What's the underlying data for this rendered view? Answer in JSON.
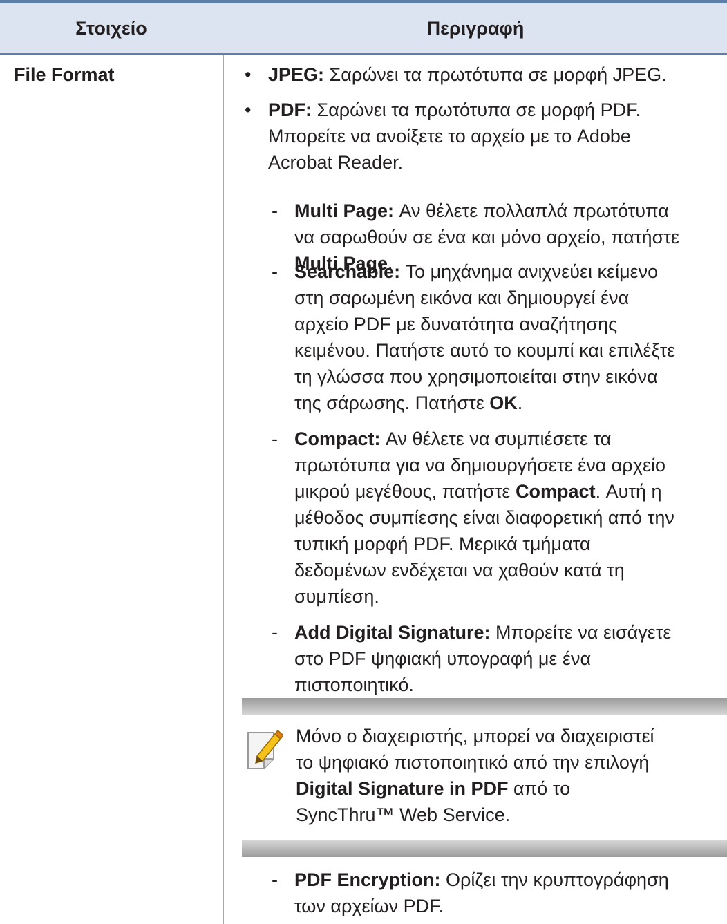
{
  "header": {
    "col_item": "Στοιχείο",
    "col_desc": "Περιγραφή"
  },
  "row": {
    "item": "File Format",
    "jpeg": {
      "label": "JPEG:",
      "text": " Σαρώνει τα πρωτότυπα σε μορφή JPEG."
    },
    "pdf": {
      "label": "PDF:",
      "line1": " Σαρώνει τα πρωτότυπα σε μορφή PDF.",
      "line2": "Μπορείτε να ανοίξετε το αρχείο με το Adobe",
      "line3": "Acrobat Reader."
    },
    "multi_page": {
      "label": "Multi Page:",
      "line1": " Αν θέλετε πολλαπλά πρωτότυπα",
      "line2": "να σαρωθούν σε ένα και μόνο αρχείο, πατήστε",
      "line3_bold": "Multi Page",
      "line3_end": "."
    },
    "searchable": {
      "label": "Searchable:",
      "line1": " Το μηχάνημα ανιχνεύει κείμενο",
      "line2": "στη σαρωμένη εικόνα και δημιουργεί ένα",
      "line3": "αρχείο PDF με δυνατότητα αναζήτησης",
      "line4": "κειμένου. Πατήστε αυτό το κουμπί και επιλέξτε",
      "line5": "τη γλώσσα που χρησιμοποιείται στην εικόνα",
      "line6_pre": "της σάρωσης. Πατήστε ",
      "line6_bold": "OK",
      "line6_end": "."
    },
    "compact": {
      "label": "Compact:",
      "line1": " Αν θέλετε να συμπιέσετε τα",
      "line2": "πρωτότυπα για να δημιουργήσετε ένα αρχείο",
      "line3_pre": "μικρού μεγέθους, πατήστε ",
      "line3_bold": "Compact",
      "line3_end": ". Αυτή η",
      "line4": "μέθοδος συμπίεσης είναι διαφορετική από την",
      "line5": "τυπική μορφή PDF. Μερικά τμήματα",
      "line6": "δεδομένων ενδέχεται να χαθούν κατά τη",
      "line7": "συμπίεση."
    },
    "signature": {
      "label": "Add Digital Signature:",
      "line1": " Μπορείτε να εισάγετε",
      "line2": "στο PDF ψηφιακή υπογραφή με ένα",
      "line3": "πιστοποιητικό."
    },
    "note": {
      "icon": "note-pencil-icon",
      "line1": "Μόνο ο διαχειριστής, μπορεί να διαχειριστεί",
      "line2": "το ψηφιακό πιστοποιητικό από την επιλογή",
      "line3_bold": "Digital Signature in PDF",
      "line3_end": " από το",
      "line4": "SyncThru™ Web Service."
    },
    "encryption": {
      "label": "PDF Encryption:",
      "line1": " Ορίζει την κρυπτογράφηση",
      "line2": "των αρχείων PDF."
    }
  }
}
